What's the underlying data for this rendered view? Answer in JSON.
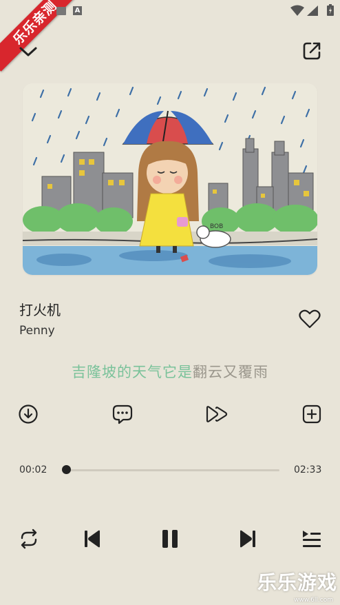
{
  "status_bar": {
    "badge_text": "乐乐亲测",
    "icons": [
      "notification-a-icon",
      "wifi-icon",
      "signal-icon",
      "battery-icon"
    ]
  },
  "header": {
    "collapse_icon": "chevron-down-icon",
    "share_icon": "share-external-icon"
  },
  "song": {
    "title": "打火机",
    "artist": "Penny",
    "favorite_icon": "heart-outline-icon"
  },
  "lyric": {
    "sung": "吉隆坡的天气它是",
    "unsung": "翻云又覆雨"
  },
  "actions": [
    {
      "name": "download",
      "icon": "download-icon"
    },
    {
      "name": "comments",
      "icon": "comment-icon"
    },
    {
      "name": "speed",
      "icon": "fast-forward-icon"
    },
    {
      "name": "add-to-playlist",
      "icon": "add-box-icon"
    }
  ],
  "progress": {
    "current": "00:02",
    "total": "02:33",
    "fraction": 0.013
  },
  "controls": [
    {
      "name": "repeat",
      "icon": "repeat-icon"
    },
    {
      "name": "previous",
      "icon": "skip-previous-icon"
    },
    {
      "name": "pause",
      "icon": "pause-icon"
    },
    {
      "name": "next",
      "icon": "skip-next-icon"
    },
    {
      "name": "playlist",
      "icon": "queue-list-icon"
    }
  ],
  "watermark": {
    "text": "乐乐游戏",
    "sub": "www.6ll.com"
  },
  "colors": {
    "background": "#e8e4d8",
    "lyric_sung": "#7ac29a",
    "lyric_unsung": "#9a968c",
    "ribbon": "#d8262d"
  }
}
